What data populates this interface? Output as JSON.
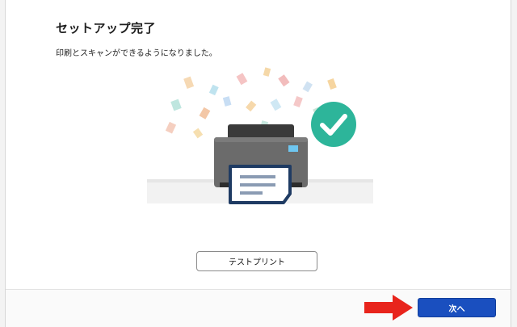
{
  "dialog": {
    "title": "セットアップ完了",
    "message": "印刷とスキャンができるようになりました。"
  },
  "buttons": {
    "test_print_label": "テストプリント",
    "next_label": "次へ"
  },
  "illustration": {
    "icons": [
      "confetti",
      "printer-icon",
      "check-circle-icon",
      "document-icon"
    ]
  },
  "colors": {
    "accent_blue": "#1a4fbf",
    "success_green": "#2db59a",
    "annotation_red": "#e8241c",
    "printer_body": "#6b6b6b",
    "printer_top": "#3a3a3a"
  }
}
